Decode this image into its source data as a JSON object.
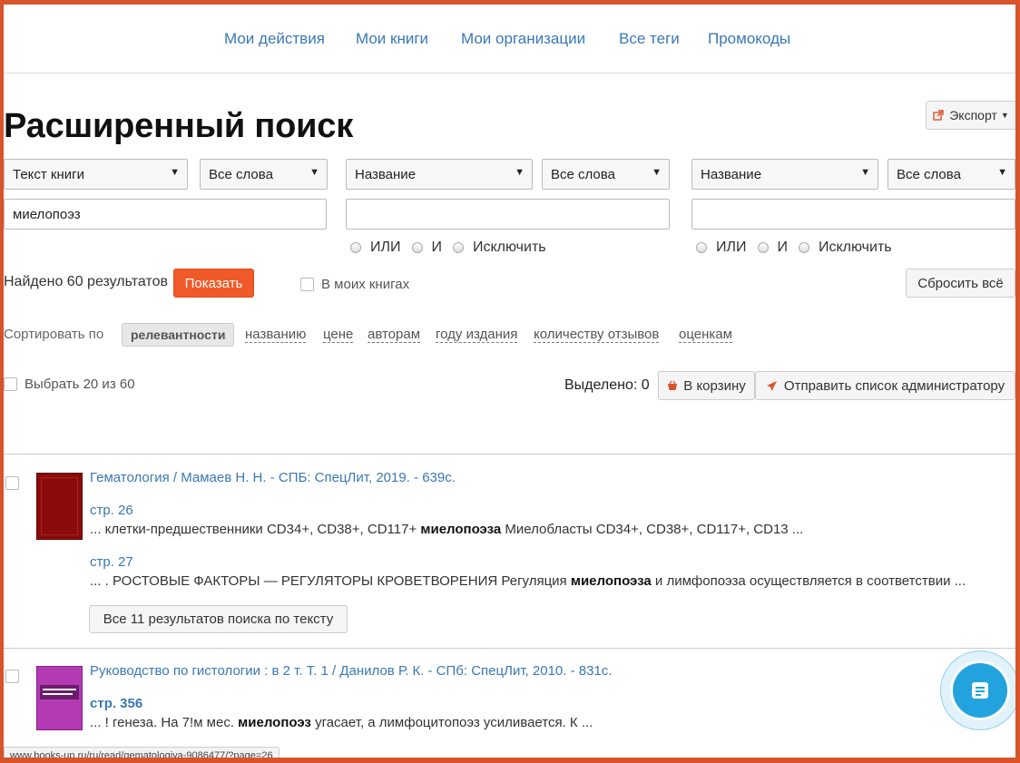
{
  "nav": {
    "items": [
      "Мои действия",
      "Мои книги",
      "Мои организации",
      "Все теги",
      "Промокоды"
    ]
  },
  "page_title": "Расширенный поиск",
  "export_label": "Экспорт",
  "search": {
    "row1": {
      "field": "Текст книги",
      "mode": "Все слова",
      "value": "миелопоэз"
    },
    "row2": {
      "field": "Название",
      "mode": "Все слова",
      "value": "",
      "logic": [
        "ИЛИ",
        "И",
        "Исключить"
      ]
    },
    "row3": {
      "field": "Название",
      "mode": "Все слова",
      "value": "",
      "logic": [
        "ИЛИ",
        "И",
        "Исключить"
      ]
    }
  },
  "found_text": "Найдено 60 результатов",
  "show_button": "Показать",
  "in_my_books": "В моих книгах",
  "reset_button": "Сбросить всё",
  "sort": {
    "label": "Сортировать по",
    "active": "релевантности",
    "options": [
      "названию",
      "цене",
      "авторам",
      "году издания",
      "количеству отзывов",
      "оценкам"
    ]
  },
  "select_all": "Выбрать 20 из 60",
  "selected_text": "Выделено: 0",
  "to_cart": "В корзину",
  "send_admin": "Отправить список администратору",
  "results": [
    {
      "title": "Гематология / Мамаев Н. Н. - СПБ: СпецЛит, 2019. - 639с.",
      "hits": [
        {
          "page": "стр. 26",
          "before": "... клетки-предшественники CD34+, CD38+, CD117+ ",
          "term": "миелопоэза",
          "after": " Миелобласты CD34+, CD38+, CD117+, CD13 ..."
        },
        {
          "page": "стр. 27",
          "before": "... . РОСТОВЫЕ ФАКТОРЫ — РЕГУЛЯТОРЫ КРОВЕТВОРЕНИЯ Регуляция ",
          "term": "миелопоэза",
          "after": " и лимфопоэза осуществляется в соответствии ..."
        }
      ],
      "all_results": "Все 11 результатов поиска по тексту"
    },
    {
      "title": "Руководство по гистологии : в 2 т. Т. 1 / Данилов Р. К. - СПб: СпецЛит, 2010. - 831с.",
      "hits": [
        {
          "page": "стр. 356",
          "before": "... ! генеза. На 7!м мес. ",
          "term": "миелопоэз",
          "after": " угасает, а лимфоцитопоэз усиливается. К ..."
        }
      ]
    }
  ],
  "status_url": "www.books-up.ru/ru/read/gematologiya-9086477/?page=26",
  "colors": {
    "frame": "#d9532b",
    "link": "#3a78b5",
    "primary_button": "#f05a28",
    "chat": "#22a3dd"
  }
}
